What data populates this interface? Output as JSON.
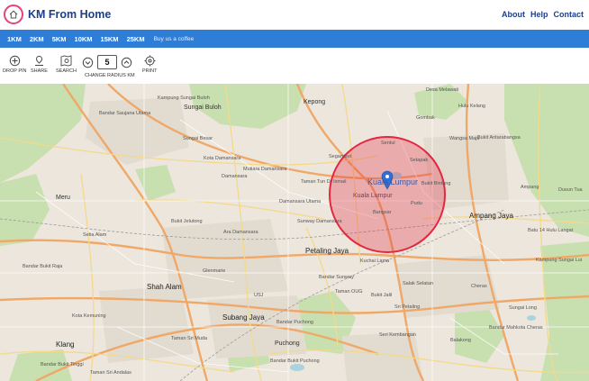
{
  "header": {
    "brand": "KM From Home",
    "nav": {
      "about": "About",
      "help": "Help",
      "contact": "Contact"
    }
  },
  "radius_bar": {
    "options": [
      "1KM",
      "2KM",
      "5KM",
      "10KM",
      "15KM",
      "25KM"
    ],
    "coffee": "Buy us a coffee"
  },
  "toolbar": {
    "drop_pin": "DROP PIN",
    "share": "SHARE",
    "search": "SEARCH",
    "change_radius": "CHANGE RADIUS KM",
    "radius_value": "5",
    "print": "PRINT"
  },
  "map": {
    "places": {
      "kepong": "Kepong",
      "sungai_buloh": "Sungai Buloh",
      "sungai_besar": "Sungai Besar",
      "kota_damansara": "Kota Damansara",
      "mutiara_damansara": "Mutiara Damansara",
      "damansara": "Damansara",
      "taman_tun": "Taman Tun Dr Ismail",
      "damansara_utama": "Damansara Utama",
      "bukit_jelutong": "Bukit Jelutong",
      "ara_damansara": "Ara Damansara",
      "petaling_jaya": "Petaling Jaya",
      "shah_alam": "Shah Alam",
      "subang_jaya": "Subang Jaya",
      "puchong": "Puchong",
      "klang": "Klang",
      "kuala_lumpur": "Kuala Lumpur",
      "kuala_lumpur_2": "Kuala Lumpur",
      "ampang_jaya": "Ampang Jaya",
      "sentul": "Sentul",
      "setapak": "Setapak",
      "wangsa_maju": "Wangsa Maju",
      "cheras": "Cheras",
      "seri_kembangan": "Seri Kembangan",
      "hulu_kelang": "Hulu Kelang",
      "batu_14": "Batu 14 Hulu Langat",
      "bukit_antarabangsa": "Bukit Antarabangsa",
      "kampung_sungai_buloh": "Kampung Sungai Buloh",
      "bandar_saujana": "Bandar Saujana Utama",
      "meru": "Meru",
      "setia_alam": "Setia Alam",
      "bandar_bukit_raja": "Bandar Bukit Raja",
      "bandar_sunway": "Bandar Sunway",
      "bukit_jalil": "Bukit Jalil",
      "taman_oug": "Taman OUG",
      "salak_selatan": "Salak Selatan",
      "pudu": "Pudu",
      "bangsar": "Bangsar",
      "desa_melawati": "Desa Melawati",
      "kuchai_lama": "Kuchai Lama",
      "bandar_puchong": "Bandar Puchong",
      "taman_sri_muda": "Taman Sri Muda",
      "bandar_bukit_tinggi": "Bandar Bukit Tinggi",
      "bandar_mahkota": "Bandar Mahkota Cheras",
      "balakong": "Balakong",
      "ampang": "Ampang",
      "gombak": "Gombak",
      "segambut": "Segambut",
      "bukit_bintang": "Bukit Bintang",
      "kota_kemuning": "Kota Kemuning",
      "glenmarie": "Glenmarie",
      "usj": "USJ",
      "sri_petaling": "Sri Petaling",
      "kampung_sungai_lui": "Kampung Sungai Lui",
      "sungai_long": "Sungai Long",
      "dusun_tua": "Dusun Tua",
      "bandar_bukit_puchong": "Bandar Bukit Puchong",
      "taman_sri_andalas": "Taman Sri Andalas",
      "sunway_damansara": "Sunway Damansara"
    },
    "circle_color": "#e5263f",
    "pin_color": "#2f6fd6"
  },
  "colors": {
    "accent": "#e0457b",
    "brand": "#1c3f8c",
    "bar": "#2e7dd6"
  }
}
